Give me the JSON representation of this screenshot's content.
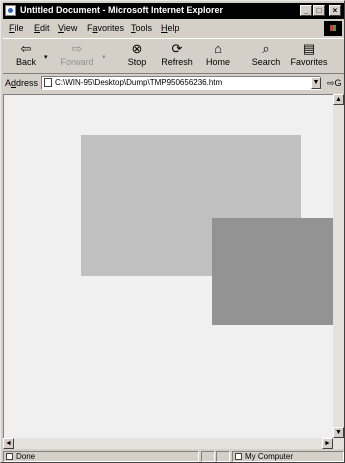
{
  "window": {
    "title": "Untitled Document - Microsoft Internet Explorer",
    "controls": {
      "minimize": "_",
      "maximize": "□",
      "close": "×"
    }
  },
  "menu": {
    "items": [
      {
        "ul": "F",
        "rest": "ile"
      },
      {
        "ul": "E",
        "rest": "dit"
      },
      {
        "ul": "V",
        "rest": "iew"
      },
      {
        "pre": "F",
        "ul": "a",
        "rest": "vorites"
      },
      {
        "ul": "T",
        "rest": "ools"
      },
      {
        "ul": "H",
        "rest": "elp"
      }
    ]
  },
  "toolbar": {
    "back": {
      "label": "Back",
      "icon": "back-arrow-icon",
      "glyph": "⇦"
    },
    "forward": {
      "label": "Forward",
      "icon": "forward-arrow-icon",
      "glyph": "⇨"
    },
    "stop": {
      "label": "Stop",
      "icon": "stop-icon",
      "glyph": "⊗"
    },
    "refresh": {
      "label": "Refresh",
      "icon": "refresh-icon",
      "glyph": "⟳"
    },
    "home": {
      "label": "Home",
      "icon": "home-icon",
      "glyph": "⌂"
    },
    "search": {
      "label": "Search",
      "icon": "search-icon",
      "glyph": "⌕"
    },
    "favorites": {
      "label": "Favorites",
      "icon": "favorites-icon",
      "glyph": "▤"
    },
    "dropdown_glyph": "▾"
  },
  "address": {
    "label_pre": "A",
    "label_ul": "d",
    "label_rest": "dress",
    "value": "C:\\WIN-95\\Desktop\\Dump\\TMP950656236.htm",
    "dropdown_glyph": "▼",
    "go_label": "⇨G"
  },
  "scrollbar": {
    "up": "▲",
    "down": "▼",
    "left": "◄",
    "right": "►"
  },
  "status": {
    "text": "Done",
    "zone": "My Computer"
  },
  "colors": {
    "chrome": "#d4d0c8",
    "content_bg": "#f0f0f0",
    "rect_light": "#c0c0c0",
    "rect_dark": "#939393"
  }
}
